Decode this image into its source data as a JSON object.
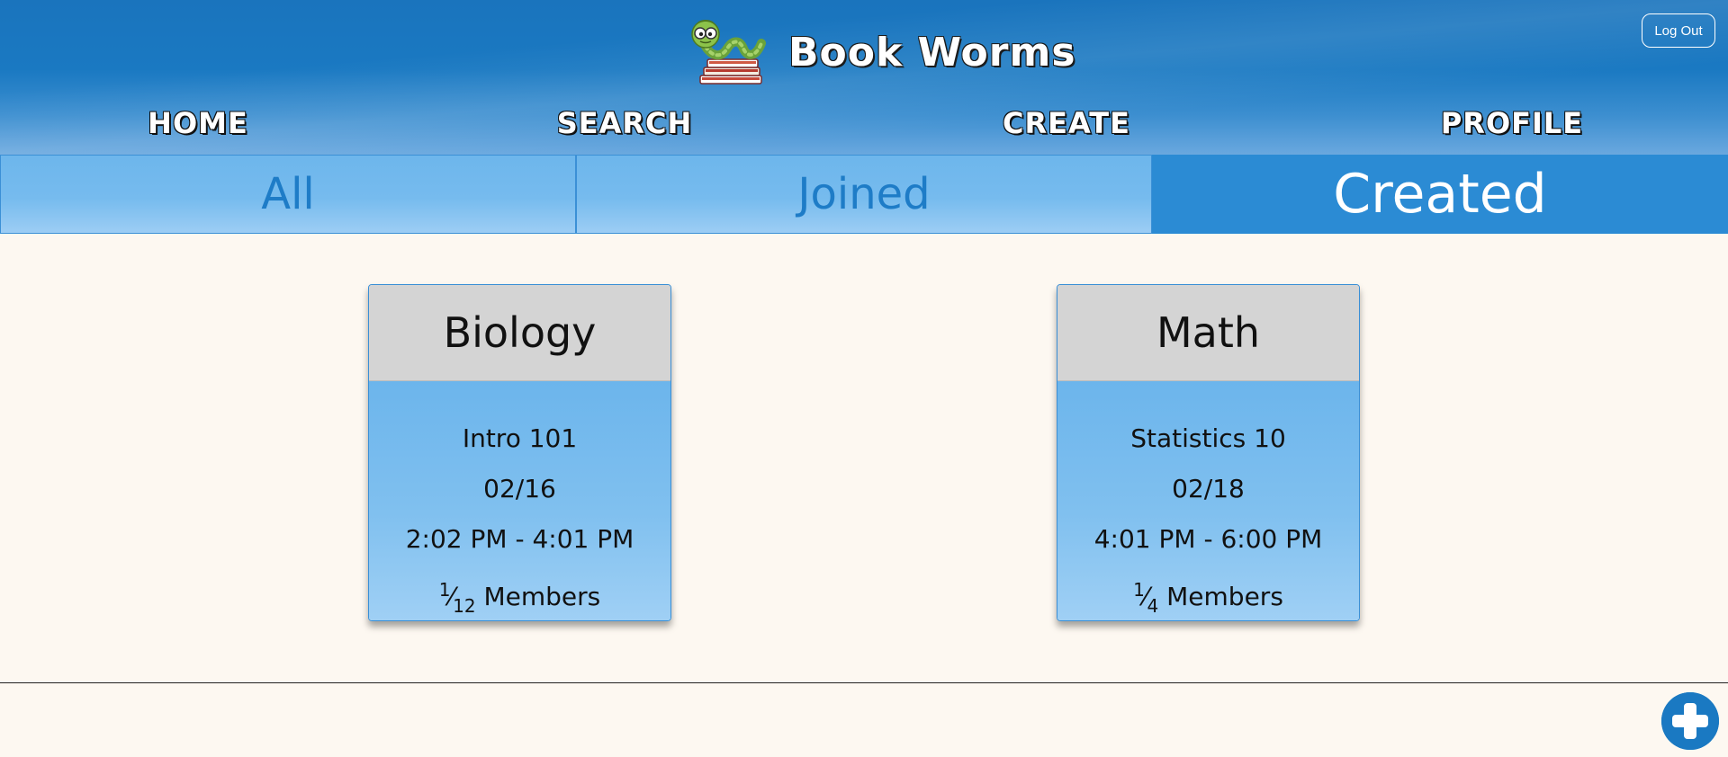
{
  "app": {
    "title": "Book Worms",
    "logo_icon": "bookworm-logo-icon",
    "logout_label": "Log Out"
  },
  "nav": {
    "items": [
      {
        "label": "HOME"
      },
      {
        "label": "SEARCH"
      },
      {
        "label": "CREATE"
      },
      {
        "label": "PROFILE"
      }
    ]
  },
  "tabs": [
    {
      "label": "All",
      "active": false
    },
    {
      "label": "Joined",
      "active": false
    },
    {
      "label": "Created",
      "active": true
    }
  ],
  "groups": [
    {
      "subject": "Biology",
      "course": "Intro 101",
      "date": "02/16",
      "time": "2:02 PM - 4:01 PM",
      "members_current": "1",
      "members_max": "12",
      "members_label": "Members"
    },
    {
      "subject": "Math",
      "course": "Statistics 10",
      "date": "02/18",
      "time": "4:01 PM - 6:00 PM",
      "members_current": "1",
      "members_max": "4",
      "members_label": "Members"
    }
  ],
  "fab": {
    "icon": "plus-icon"
  },
  "colors": {
    "header_blue": "#1a79c2",
    "tab_active": "#2b8bd4",
    "tab_inactive_text": "#1e7cc7",
    "card_head": "#d4d4d4",
    "background": "#fdf8f1"
  }
}
